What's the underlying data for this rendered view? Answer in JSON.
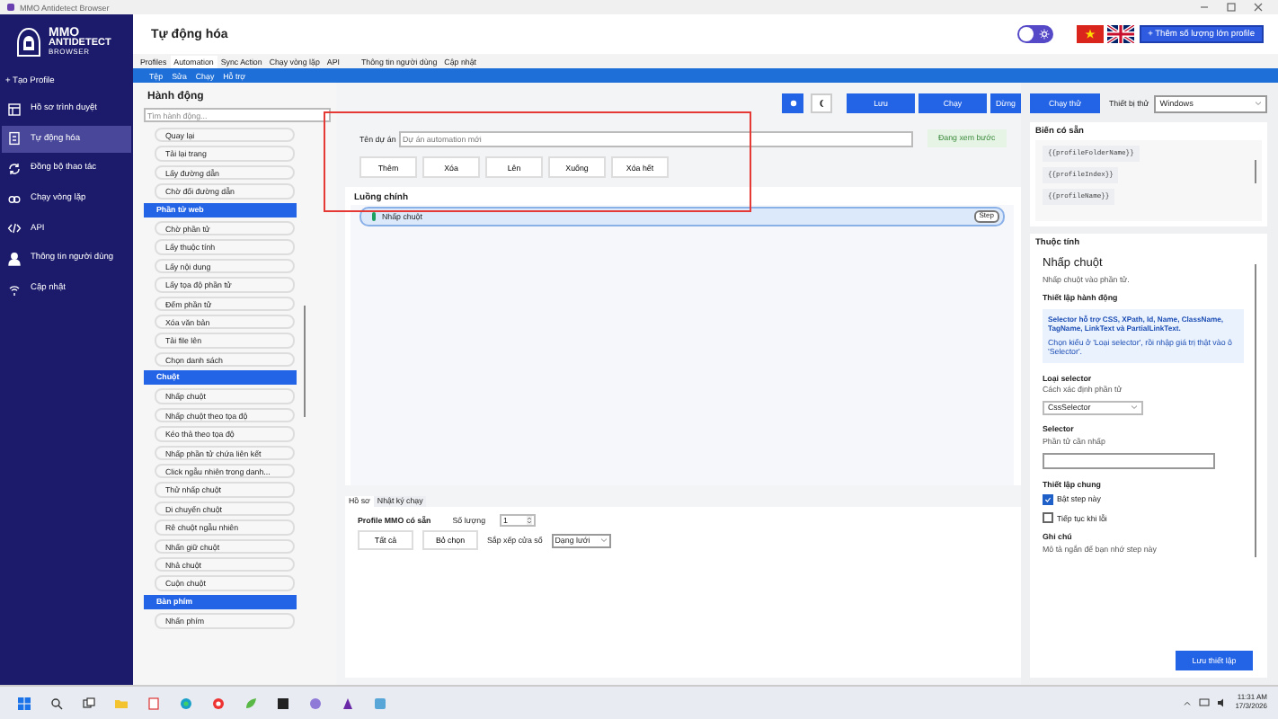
{
  "window": {
    "title": "MMO Antidetect Browser"
  },
  "logo": {
    "line1": "MMO",
    "line2": "ANTIDETECT",
    "line3": "BROWSER"
  },
  "sidebar": {
    "create": "+ Tạo Profile",
    "items": [
      {
        "label": "Hồ sơ trình duyệt",
        "kind": "browser",
        "selected": false
      },
      {
        "label": "Tự động hóa",
        "kind": "automation",
        "selected": true
      },
      {
        "label": "Đồng bộ thao tác",
        "kind": "sync",
        "selected": false
      },
      {
        "label": "Chạy vòng lặp",
        "kind": "loop",
        "selected": false
      },
      {
        "label": "API",
        "kind": "api",
        "selected": false
      },
      {
        "label": "Thông tin người dùng",
        "kind": "user",
        "selected": false
      },
      {
        "label": "Cập nhật",
        "kind": "update",
        "selected": false
      }
    ]
  },
  "header": {
    "title": "Tự động hóa",
    "theme_toggle_on": false,
    "languages": [
      {
        "kind": "vn"
      },
      {
        "kind": "uk"
      }
    ],
    "bulk_button": "+ Thêm số lượng lớn profile"
  },
  "tabs": [
    {
      "label": "Profiles",
      "selected": false
    },
    {
      "label": "Automation",
      "selected": true
    },
    {
      "label": "Sync Action",
      "selected": false
    },
    {
      "label": "Chạy vòng lặp",
      "selected": false
    },
    {
      "label": "API",
      "selected": false
    },
    {
      "label": "Thông tin người dùng",
      "selected": false
    },
    {
      "label": "Cập nhật",
      "selected": false
    }
  ],
  "menu": [
    "Tệp",
    "Sửa",
    "Chạy",
    "Hỗ trợ"
  ],
  "actions": {
    "title": "Hành động",
    "search_placeholder": "Tìm hành động...",
    "entries": [
      {
        "kind": "item",
        "label": "Quay lại"
      },
      {
        "kind": "item",
        "label": "Tải lại trang"
      },
      {
        "kind": "item",
        "label": "Lấy đường dẫn"
      },
      {
        "kind": "item",
        "label": "Chờ đổi đường dẫn"
      },
      {
        "kind": "header",
        "label": "Phần tử web"
      },
      {
        "kind": "item",
        "label": "Chờ phần tử"
      },
      {
        "kind": "item",
        "label": "Lấy thuộc tính"
      },
      {
        "kind": "item",
        "label": "Lấy nội dung"
      },
      {
        "kind": "item",
        "label": "Lấy tọa độ phần tử"
      },
      {
        "kind": "item",
        "label": "Đếm phần tử"
      },
      {
        "kind": "item",
        "label": "Xóa văn bản"
      },
      {
        "kind": "item",
        "label": "Tải file lên"
      },
      {
        "kind": "item",
        "label": "Chọn danh sách"
      },
      {
        "kind": "header",
        "label": "Chuột"
      },
      {
        "kind": "item",
        "label": "Nhấp chuột"
      },
      {
        "kind": "item",
        "label": "Nhấp chuột theo tọa độ"
      },
      {
        "kind": "item",
        "label": "Kéo thả theo tọa độ"
      },
      {
        "kind": "item",
        "label": "Nhấp phần tử chứa liên kết"
      },
      {
        "kind": "item",
        "label": "Click ngẫu nhiên trong danh..."
      },
      {
        "kind": "item",
        "label": "Thử nhấp chuột"
      },
      {
        "kind": "item",
        "label": "Di chuyển chuột"
      },
      {
        "kind": "item",
        "label": "Rê chuột ngẫu nhiên"
      },
      {
        "kind": "item",
        "label": "Nhấn giữ chuột"
      },
      {
        "kind": "item",
        "label": "Nhả chuột"
      },
      {
        "kind": "item",
        "label": "Cuộn chuột"
      },
      {
        "kind": "header",
        "label": "Bàn phím"
      },
      {
        "kind": "item",
        "label": "Nhấn phím"
      }
    ]
  },
  "toolbar": [
    {
      "kind": "sun"
    },
    {
      "kind": "moon"
    },
    {
      "kind": "text",
      "label": "Lưu"
    },
    {
      "kind": "text",
      "label": "Chạy"
    },
    {
      "kind": "text",
      "label": "Dừng"
    }
  ],
  "project": {
    "label": "Tên dự án",
    "placeholder": "Dự án automation mới",
    "status": "Đang xem bước"
  },
  "step_buttons": [
    "Thêm",
    "Xóa",
    "Lên",
    "Xuống",
    "Xóa hết"
  ],
  "highlight_frame": true,
  "flow": {
    "title": "Luồng chính",
    "steps": [
      {
        "label": "Nhấp chuột",
        "badge": "Step",
        "enabled": true,
        "selected": true
      }
    ]
  },
  "bottom": {
    "tabs": [
      {
        "label": "Hồ sơ",
        "selected": true
      },
      {
        "label": "Nhật ký chạy",
        "selected": false
      }
    ],
    "profile_label": "Profile MMO có sẵn",
    "count_label": "Số lượng",
    "count": "1",
    "buttons": [
      "Tất cả",
      "Bỏ chọn"
    ],
    "arrange_label": "Sắp xếp cửa sổ",
    "arrange_value": "Dạng lưới"
  },
  "right": {
    "run_button": "Chạy thử",
    "device_label": "Thiết bị thử",
    "device": "Windows",
    "variables": {
      "title": "Biến có sẵn",
      "items": [
        "{{profileFolderName}}",
        "{{profileIndex}}",
        "{{profileName}}"
      ]
    },
    "properties": {
      "title": "Thuộc tính",
      "name": "Nhấp chuột",
      "description": "Nhấp chuột vào phần tử.",
      "section": "Thiết lập hành động",
      "info_bold": "Selector hỗ trợ CSS, XPath, Id, Name, ClassName, TagName, LinkText và PartialLinkText.",
      "info": "Chọn kiểu ở 'Loại selector', rồi nhập giá trị thật vào ô 'Selector'.",
      "type_label": "Loại selector",
      "type_hint": "Cách xác định phần tử",
      "type_value": "CssSelector",
      "selector_label": "Selector",
      "selector_hint": "Phần tử cần nhấp",
      "general_label": "Thiết lập chung",
      "options": [
        {
          "label": "Bật step này",
          "checked": true
        },
        {
          "label": "Tiếp tục khi lỗi",
          "checked": false
        }
      ],
      "note_label": "Ghi chú",
      "note_hint": "Mô tả ngắn để bạn nhớ step này",
      "save_button": "Lưu thiết lập"
    }
  },
  "taskbar": {
    "time": "11:31 AM",
    "date": "17/3/2026"
  }
}
